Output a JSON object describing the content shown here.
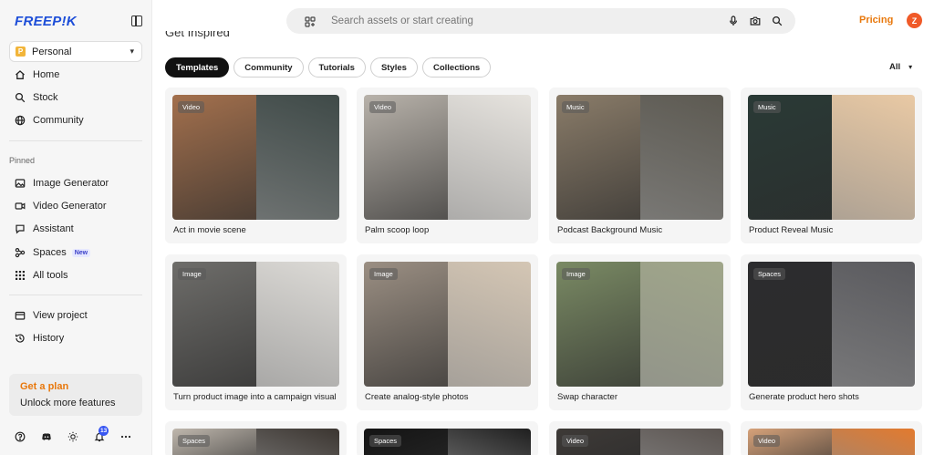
{
  "brand": {
    "logo": "FREEP!K",
    "accent": "#1d4ed8",
    "orange": "#e8780c"
  },
  "sidebar": {
    "workspace": {
      "badge": "P",
      "label": "Personal"
    },
    "nav": [
      {
        "label": "Home",
        "icon": "home-icon"
      },
      {
        "label": "Stock",
        "icon": "search-icon"
      },
      {
        "label": "Community",
        "icon": "globe-icon"
      }
    ],
    "pinned_label": "Pinned",
    "pinned": [
      {
        "label": "Image Generator",
        "icon": "image-icon"
      },
      {
        "label": "Video Generator",
        "icon": "video-icon"
      },
      {
        "label": "Assistant",
        "icon": "chat-icon"
      },
      {
        "label": "Spaces",
        "icon": "spaces-icon",
        "badge": "New"
      },
      {
        "label": "All tools",
        "icon": "grid-icon"
      }
    ],
    "secondary": [
      {
        "label": "View project",
        "icon": "folder-icon"
      },
      {
        "label": "History",
        "icon": "history-icon"
      }
    ],
    "plan": {
      "title": "Get a plan",
      "subtitle": "Unlock more features"
    },
    "notifications_count": "13"
  },
  "header": {
    "search_placeholder": "Search assets or start creating",
    "pricing": "Pricing",
    "avatar_initial": "Z"
  },
  "section": {
    "title": "Get Inspired",
    "tabs": [
      "Templates",
      "Community",
      "Tutorials",
      "Styles",
      "Collections"
    ],
    "active_tab": "Templates",
    "filter": "All"
  },
  "cards": [
    {
      "badge": "Video",
      "title": "Act in movie scene",
      "colors": [
        "#a3704d",
        "#3f4a48"
      ]
    },
    {
      "badge": "Video",
      "title": "Palm scoop loop",
      "colors": [
        "#b8b2aa",
        "#e6e3de"
      ]
    },
    {
      "badge": "Music",
      "title": "Podcast Background Music",
      "colors": [
        "#8a7c69",
        "#5d5a52"
      ]
    },
    {
      "badge": "Music",
      "title": "Product Reveal Music",
      "colors": [
        "#2a3a36",
        "#e9c9a4"
      ]
    },
    {
      "badge": "Image",
      "title": "Turn product image into a campaign visual",
      "colors": [
        "#6e6d6a",
        "#dcdad6"
      ]
    },
    {
      "badge": "Image",
      "title": "Create analog-style photos",
      "colors": [
        "#9b8f83",
        "#d4c6b4"
      ]
    },
    {
      "badge": "Image",
      "title": "Swap character",
      "colors": [
        "#7a8a64",
        "#a0a68a"
      ]
    },
    {
      "badge": "Spaces",
      "title": "Generate product hero shots",
      "colors": [
        "#2c2c2e",
        "#5a5a5e"
      ]
    },
    {
      "badge": "Spaces",
      "title": "",
      "colors": [
        "#bfb7ad",
        "#3b3530"
      ]
    },
    {
      "badge": "Spaces",
      "title": "",
      "colors": [
        "#141414",
        "#1f1f1f"
      ]
    },
    {
      "badge": "Video",
      "title": "",
      "colors": [
        "#3e3a37",
        "#5b5450"
      ]
    },
    {
      "badge": "Video",
      "title": "",
      "colors": [
        "#d6a27a",
        "#e37a2e"
      ]
    }
  ]
}
